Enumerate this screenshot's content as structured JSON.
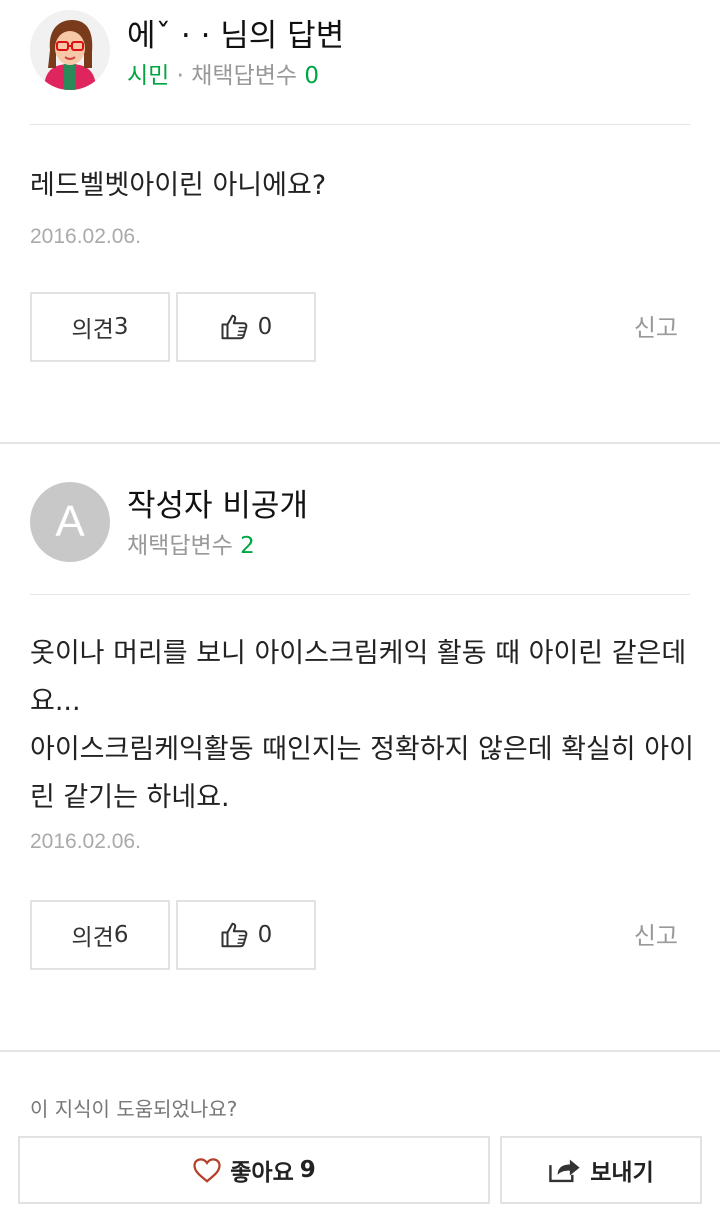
{
  "answers": [
    {
      "author": "에ˇ ·  ·  님의 답변",
      "level": "시민",
      "adopt_label": "· 채택답변수",
      "adopt_count": "0",
      "content": "레드벨벳아이린 아니에요?",
      "date": "2016.02.06.",
      "opinion_label": "의견",
      "opinion_count": "3",
      "like_count": "0",
      "report_label": "신고"
    },
    {
      "author": "작성자 비공개",
      "avatar_letter": "A",
      "adopt_label": "채택답변수",
      "adopt_count": "2",
      "content": "옷이나 머리를 보니 아이스크림케익 활동 때 아이린 같은데요...\n아이스크림케익활동 때인지는 정확하지 않은데 확실히 아이린 같기는 하네요.",
      "date": "2016.02.06.",
      "opinion_label": "의견",
      "opinion_count": "6",
      "like_count": "0",
      "report_label": "신고"
    }
  ],
  "footer": {
    "question": "이 지식이 도움되었나요?",
    "like_label": "좋아요",
    "like_count": "9",
    "send_label": "보내기"
  },
  "icons": {
    "thumb": "thumbs-up-icon",
    "heart": "heart-icon",
    "share": "share-icon"
  },
  "colors": {
    "accent_green": "#00a543",
    "heart_red": "#b5402a"
  }
}
